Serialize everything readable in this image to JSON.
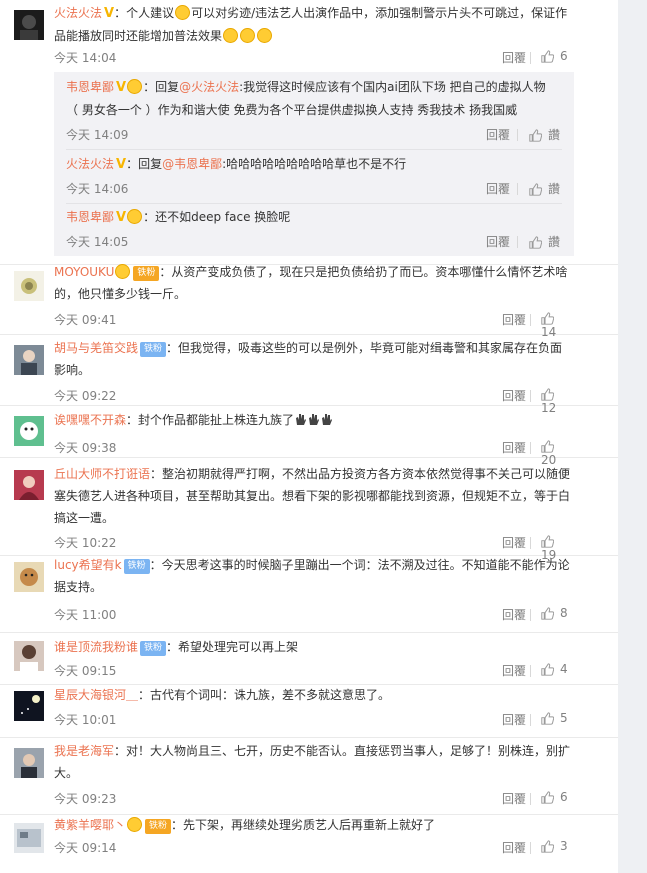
{
  "ui": {
    "reply_label": "回覆",
    "zan_label": "讚"
  },
  "top": {
    "name": "火法火法",
    "text_1": "：个人建议",
    "text_2": "可以对劣迹/违法艺人出演作品中，添加强制警示片头不可跳过，保证作品能播放同时还能增加普法效果",
    "time": "今天 14:04",
    "likes": "6"
  },
  "replies": [
    {
      "name": "韦恩卑鄙",
      "prefix": "：回复",
      "mention": "@火法火法",
      "text": ":我觉得这时候应该有个国内ai团队下场 把自己的虚拟人物（ 男女各一个 ）作为和谐大使 免费为各个平台提供虚拟换人支持 秀我技术 扬我国威",
      "time": "今天 14:09"
    },
    {
      "name": "火法火法",
      "prefix": "：回复",
      "mention": "@韦恩卑鄙",
      "text": ":哈哈哈哈哈哈哈哈哈草也不是不行",
      "time": "今天 14:06"
    },
    {
      "name": "韦恩卑鄙",
      "prefix": "",
      "mention": "",
      "text": "：还不如deep face 换脸呢",
      "time": "今天 14:05"
    }
  ],
  "comments": [
    {
      "name": "MOYOUKU",
      "badge": "铁粉",
      "text": "：从资产变成负债了，现在只是把负债给扔了而已。资本哪懂什么情怀艺术啥的，他只懂多少钱一斤。",
      "time": "今天 09:41",
      "likes": "14"
    },
    {
      "name": "胡马与羌笛交践",
      "badge": "铁粉",
      "text": "：但我觉得，吸毒这些的可以是例外，毕竟可能对缉毒警和其家属存在负面影响。",
      "time": "今天 09:22",
      "likes": "12"
    },
    {
      "name": "诶嘿嘿不开森",
      "badge": "",
      "text": "：封个作品都能扯上株连九族了",
      "time": "今天 09:38",
      "likes": "20"
    },
    {
      "name": "丘山大师不打诳语",
      "badge": "",
      "text": "：整治初期就得严打啊，不然出品方投资方各方资本依然觉得事不关己可以随便塞失德艺人进各种项目，甚至帮助其复出。想看下架的影视哪都能找到资源，但规矩不立，等于白搞这一遭。",
      "time": "今天 10:22",
      "likes": "19"
    },
    {
      "name": "lucy希望有k",
      "badge": "铁粉",
      "text": "：今天思考这事的时候脑子里蹦出一个词：法不溯及过往。不知道能不能作为论据支持。",
      "time": "今天 11:00",
      "likes": "8"
    },
    {
      "name": "谁是顶流我粉谁",
      "badge": "铁粉",
      "text": "：希望处理完可以再上架",
      "time": "今天 09:15",
      "likes": "4"
    },
    {
      "name": "星辰大海银河＿",
      "badge": "",
      "text": "：古代有个词叫：诛九族，差不多就这意思了。",
      "time": "今天 10:01",
      "likes": "5"
    },
    {
      "name": "我是老海军",
      "badge": "",
      "text": "：对！大人物尚且三、七开，历史不能否认。直接惩罚当事人，足够了！别株连，别扩大。",
      "time": "今天 09:23",
      "likes": "6"
    },
    {
      "name": "黄紫羊嘤耶丶",
      "badge": "铁粉",
      "text": "：先下架，再继续处理劣质艺人后再重新上就好了",
      "time": "今天 09:14",
      "likes": "3"
    }
  ],
  "colors": {
    "username": "#eb7350",
    "meta": "#808080",
    "subbox": "#f2f2f5",
    "fan_badge": "#7bb4f2"
  },
  "icons": {
    "like": "thumbs-up-icon",
    "verified": "v-badge-icon",
    "emoji": "smile-emoji-icon",
    "hand": "clapping-hands-icon"
  }
}
